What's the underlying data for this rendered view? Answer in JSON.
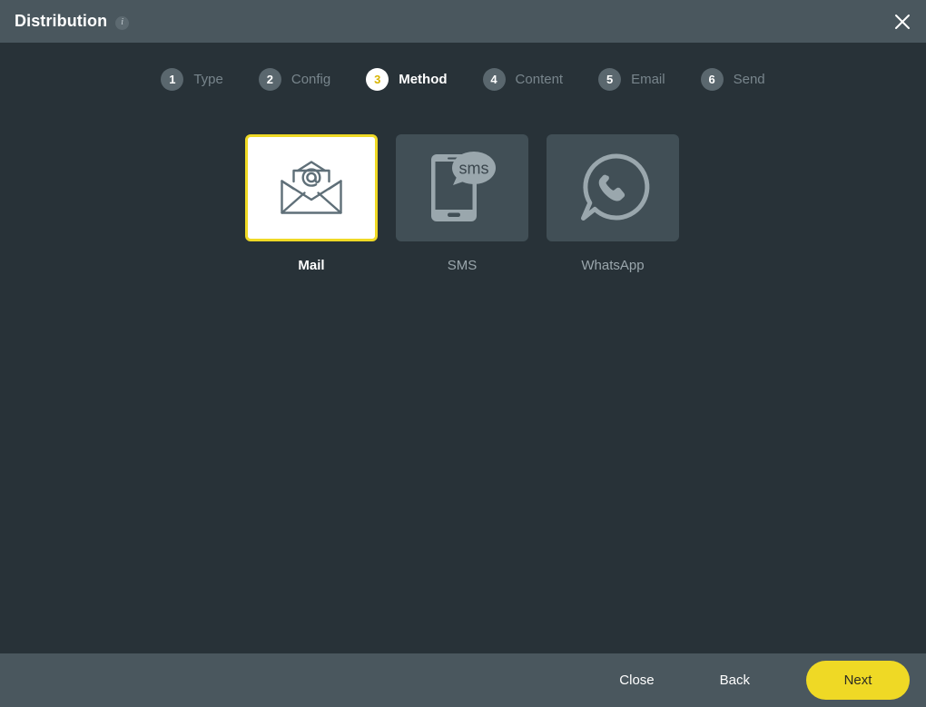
{
  "window": {
    "title": "Distribution",
    "info_icon": "info-icon",
    "close_icon": "close-icon"
  },
  "stepper": {
    "steps": [
      {
        "number": "1",
        "label": "Type",
        "active": false
      },
      {
        "number": "2",
        "label": "Config",
        "active": false
      },
      {
        "number": "3",
        "label": "Method",
        "active": true
      },
      {
        "number": "4",
        "label": "Content",
        "active": false
      },
      {
        "number": "5",
        "label": "Email",
        "active": false
      },
      {
        "number": "6",
        "label": "Send",
        "active": false
      }
    ]
  },
  "methods": [
    {
      "label": "Mail",
      "icon": "envelope-at-icon",
      "selected": true
    },
    {
      "label": "SMS",
      "icon": "phone-sms-bubble-icon",
      "selected": false
    },
    {
      "label": "WhatsApp",
      "icon": "whatsapp-icon",
      "selected": false
    }
  ],
  "footer": {
    "close_label": "Close",
    "back_label": "Back",
    "next_label": "Next"
  },
  "colors": {
    "header_bg": "#4a575e",
    "body_bg": "#283238",
    "tile_bg": "#414f56",
    "accent_yellow": "#efd925",
    "step_circle": "#5a676e",
    "muted_text": "#78858c",
    "icon_gray": "#5f6f78",
    "icon_light": "#9aa7ad"
  }
}
